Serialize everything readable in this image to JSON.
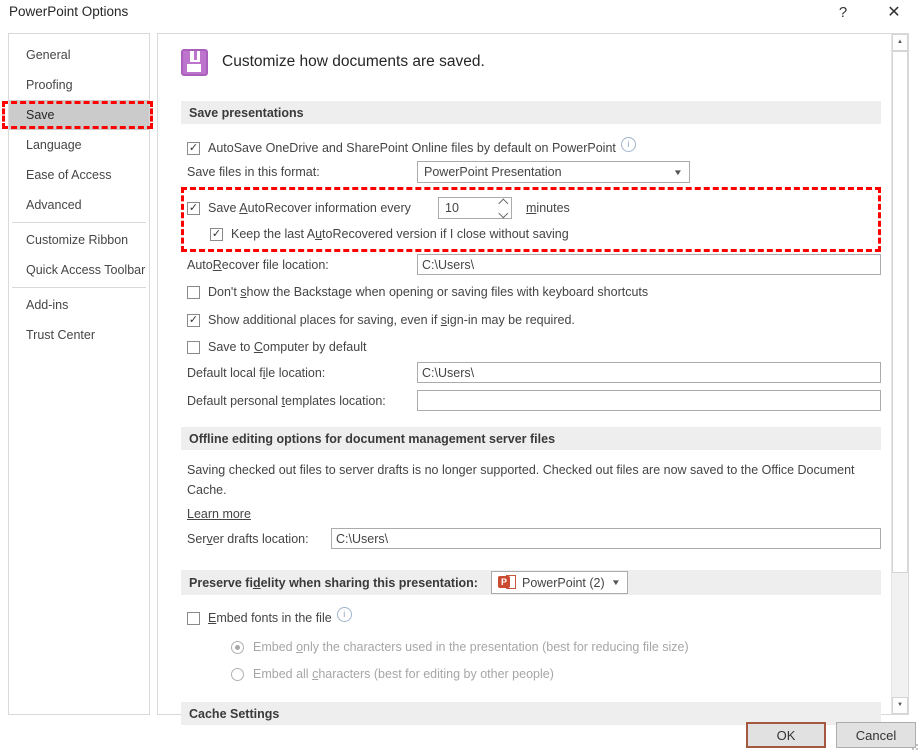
{
  "window": {
    "title": "PowerPoint Options"
  },
  "titlebar": {
    "help": "?",
    "close": "✕"
  },
  "sidebar": {
    "items": [
      {
        "label": "General"
      },
      {
        "label": "Proofing"
      },
      {
        "label": "Save"
      },
      {
        "label": "Language"
      },
      {
        "label": "Ease of Access"
      },
      {
        "label": "Advanced"
      },
      {
        "label": "Customize Ribbon"
      },
      {
        "label": "Quick Access Toolbar"
      },
      {
        "label": "Add-ins"
      },
      {
        "label": "Trust Center"
      }
    ]
  },
  "header": {
    "title": "Customize how documents are saved."
  },
  "sections": {
    "save": {
      "title": "Save presentations"
    },
    "offline": {
      "title": "Offline editing options for document management server files"
    },
    "fidelity": {
      "pre": "Preserve fi",
      "key": "d",
      "post": "elity when sharing this presentation:"
    },
    "cache": {
      "title": "Cache Settings"
    }
  },
  "fields": {
    "autosave": {
      "label": "AutoSave OneDrive and SharePoint Online files by default on PowerPoint"
    },
    "format": {
      "label": "Save files in this format:",
      "value": "PowerPoint Presentation"
    },
    "autorecover": {
      "pre": "Save ",
      "key": "A",
      "post": "utoRecover information every",
      "value": "10",
      "minutes_key": "m",
      "minutes_post": "inutes"
    },
    "keep_last": {
      "pre": "Keep the last A",
      "key": "u",
      "post": "toRecovered version if I close without saving"
    },
    "ar_location": {
      "pre": "Auto",
      "key": "R",
      "post": "ecover file location:",
      "value": "C:\\Users\\"
    },
    "backstage": {
      "pre": "Don't ",
      "key": "s",
      "post": "how the Backstage when opening or saving files with keyboard shortcuts"
    },
    "additional_places": {
      "pre": "Show additional places for saving, even if ",
      "key": "s",
      "post": "ign-in may be required."
    },
    "save_computer": {
      "pre": "Save to ",
      "key": "C",
      "post": "omputer by default"
    },
    "default_local": {
      "pre": "Default local f",
      "key": "i",
      "post": "le location:",
      "value": "C:\\Users\\"
    },
    "default_templates": {
      "pre": "Default personal ",
      "key": "t",
      "post": "emplates location:",
      "value": ""
    },
    "offline_text": "Saving checked out files to server drafts is no longer supported. Checked out files are now saved to the Office Document Cache.",
    "learn_more": "Learn more",
    "server_drafts": {
      "pre": "Ser",
      "key": "v",
      "post": "er drafts location:",
      "value": "C:\\Users\\"
    },
    "fidelity_format": {
      "value": "PowerPoint (2)"
    },
    "embed_fonts": {
      "key": "E",
      "post": "mbed fonts in the file"
    },
    "embed_only": {
      "pre": "Embed ",
      "key": "o",
      "post": "nly the characters used in the presentation (best for reducing file size)"
    },
    "embed_all": {
      "pre": "Embed all ",
      "key": "c",
      "post": "haracters (best for editing by other people)"
    }
  },
  "footer": {
    "ok": "OK",
    "cancel": "Cancel"
  },
  "icons": {
    "check": "✓",
    "dropdown_arrow": "▼",
    "scroll_up": "▲",
    "scroll_down": "▼",
    "info": "i",
    "ppt_letter": "P"
  },
  "colors": {
    "highlight_red": "#ff0000",
    "ok_border": "#a4593e",
    "floppy_purple": "#bc74cc",
    "ppt_orange": "#cb4b32"
  }
}
